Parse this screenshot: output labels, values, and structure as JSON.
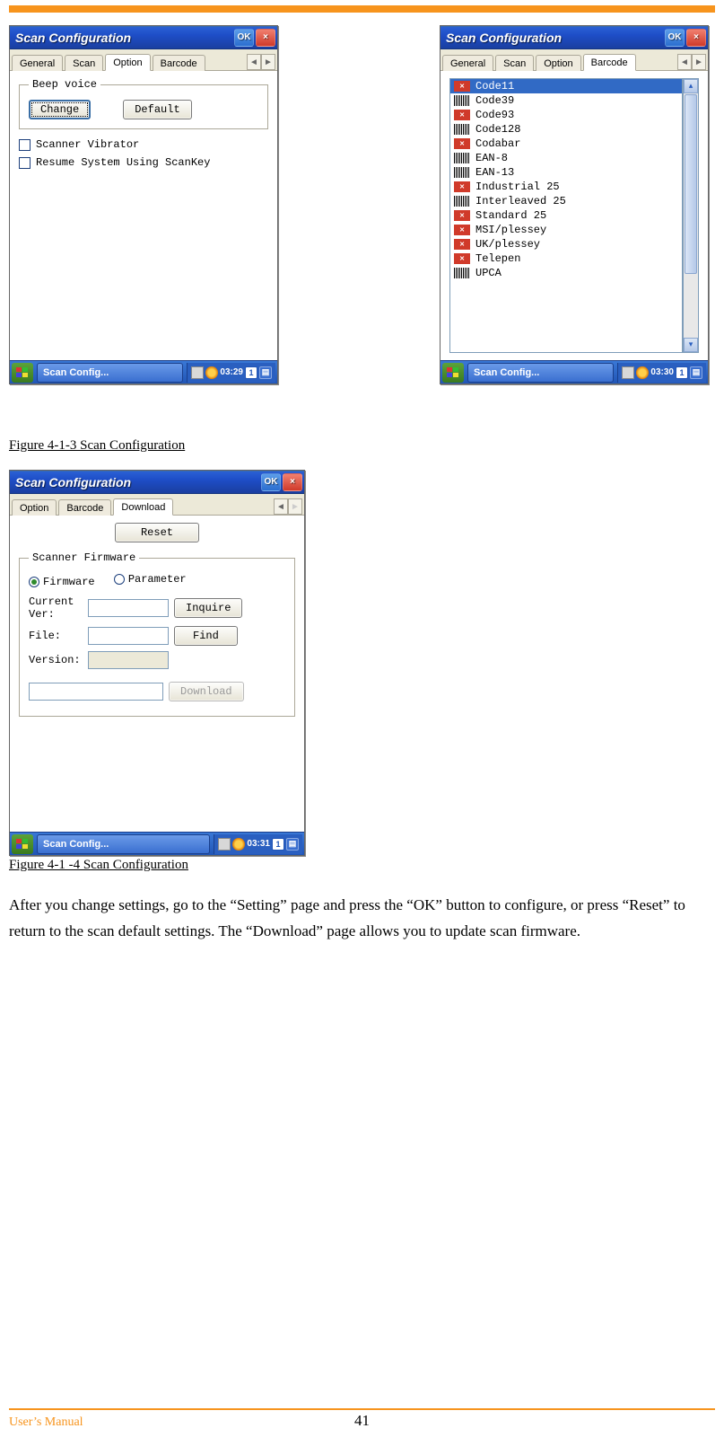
{
  "header_rule_color": "#f7941d",
  "screens": {
    "option": {
      "title": "Scan Configuration",
      "ok": "OK",
      "close": "×",
      "tabs": [
        "General",
        "Scan",
        "Option",
        "Barcode"
      ],
      "active_tab": "Option",
      "group_beep": "Beep voice",
      "btn_change": "Change",
      "btn_default": "Default",
      "chk_vibrator": "Scanner Vibrator",
      "chk_resume": "Resume System Using ScanKey",
      "taskbar_app": "Scan Config...",
      "time": "03:29",
      "sip": "1"
    },
    "barcode": {
      "title": "Scan Configuration",
      "ok": "OK",
      "close": "×",
      "tabs": [
        "General",
        "Scan",
        "Option",
        "Barcode"
      ],
      "active_tab": "Barcode",
      "items": [
        {
          "label": "Code11",
          "enabled": false,
          "selected": true
        },
        {
          "label": "Code39",
          "enabled": true
        },
        {
          "label": "Code93",
          "enabled": false
        },
        {
          "label": "Code128",
          "enabled": true
        },
        {
          "label": "Codabar",
          "enabled": false
        },
        {
          "label": "EAN-8",
          "enabled": true
        },
        {
          "label": "EAN-13",
          "enabled": true
        },
        {
          "label": "Industrial 25",
          "enabled": false
        },
        {
          "label": "Interleaved 25",
          "enabled": true
        },
        {
          "label": "Standard 25",
          "enabled": false
        },
        {
          "label": "MSI/plessey",
          "enabled": false
        },
        {
          "label": "UK/plessey",
          "enabled": false
        },
        {
          "label": "Telepen",
          "enabled": false
        },
        {
          "label": "UPCA",
          "enabled": true
        }
      ],
      "taskbar_app": "Scan Config...",
      "time": "03:30",
      "sip": "1"
    },
    "download": {
      "title": "Scan Configuration",
      "ok": "OK",
      "close": "×",
      "tabs": [
        "Option",
        "Barcode",
        "Download"
      ],
      "active_tab": "Download",
      "btn_reset": "Reset",
      "group_firmware": "Scanner Firmware",
      "radio_firmware": "Firmware",
      "radio_parameter": "Parameter",
      "lbl_current": "Current Ver:",
      "btn_inquire": "Inquire",
      "lbl_file": "File:",
      "btn_find": "Find",
      "lbl_version": "Version:",
      "btn_download": "Download",
      "taskbar_app": "Scan Config...",
      "time": "03:31",
      "sip": "1"
    }
  },
  "caption_3": "Figure 4-1-3 Scan Configuration",
  "caption_4": "Figure 4-1 -4 Scan Configuration",
  "body_text": "After you change settings, go to the “Setting” page and press the “OK” button to configure, or press “Reset” to return to the scan default settings. The “Download” page allows you to update scan firmware.",
  "footer_manual": "User’s Manual",
  "footer_page": "41"
}
